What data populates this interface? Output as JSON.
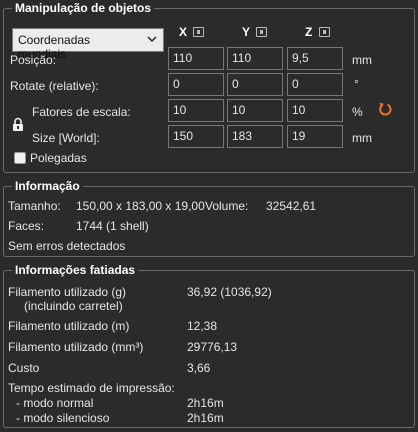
{
  "manipulation": {
    "title": "Manipulação de objetos",
    "coord_select": "Coordenadas mundiais",
    "axes": [
      "X",
      "Y",
      "Z"
    ],
    "rows": {
      "position": {
        "label": "Posição:",
        "values": [
          "110",
          "110",
          "9,5"
        ],
        "unit": "mm"
      },
      "rotate": {
        "label": "Rotate (relative):",
        "values": [
          "0",
          "0",
          "0"
        ],
        "unit": "°"
      },
      "scale": {
        "label": "Fatores de escala:",
        "values": [
          "10",
          "10",
          "10"
        ],
        "unit": "%"
      },
      "size": {
        "label": "Size [World]:",
        "values": [
          "150",
          "183",
          "19"
        ],
        "unit": "mm"
      }
    },
    "inches_label": "Polegadas",
    "inches_checked": false,
    "reset_color": "#e8742a"
  },
  "info": {
    "title": "Informação",
    "size_label": "Tamanho:",
    "size_value": "150,00 x 183,00 x 19,00",
    "volume_label": "Volume:",
    "volume_value": "32542,61",
    "faces_label": "Faces:",
    "faces_value": "1744 (1 shell)",
    "errors": "Sem erros detectados"
  },
  "sliced": {
    "title": "Informações fatiadas",
    "filament_g_label": "Filamento utilizado (g)",
    "filament_g_sub": "(incluindo carretel)",
    "filament_g_value": "36,92 (1036,92)",
    "filament_m_label": "Filamento utilizado (m)",
    "filament_m_value": "12,38",
    "filament_mm3_label": "Filamento utilizado (mm³)",
    "filament_mm3_value": "29776,13",
    "cost_label": "Custo",
    "cost_value": "3,66",
    "time_label": "Tempo estimado de impressão:",
    "normal_label": "- modo normal",
    "normal_value": "2h16m",
    "silent_label": "- modo silencioso",
    "silent_value": "2h16m"
  }
}
